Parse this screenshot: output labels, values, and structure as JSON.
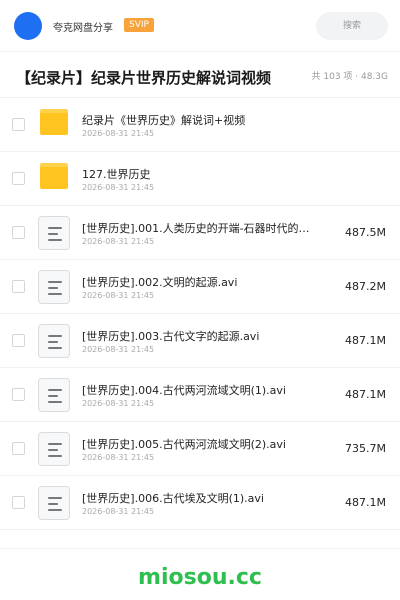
{
  "header": {
    "brand": "夸克网盘分享",
    "badge": "SVIP",
    "search_placeholder": "搜索"
  },
  "folder_title": "【纪录片】纪录片世界历史解说词视频",
  "summary": "共 103 项 · 48.3G",
  "items": [
    {
      "type": "folder",
      "name": "纪录片《世界历史》解说词+视频",
      "date": "2026-08-31 21:45",
      "size": ""
    },
    {
      "type": "folder",
      "name": "127.世界历史",
      "date": "2026-08-31 21:45",
      "size": ""
    },
    {
      "type": "file",
      "name": "[世界历史].001.人类历史的开端-石器时代的人…",
      "date": "2026-08-31 21:45",
      "size": "487.5M"
    },
    {
      "type": "file",
      "name": "[世界历史].002.文明的起源.avi",
      "date": "2026-08-31 21:45",
      "size": "487.2M"
    },
    {
      "type": "file",
      "name": "[世界历史].003.古代文字的起源.avi",
      "date": "2026-08-31 21:45",
      "size": "487.1M"
    },
    {
      "type": "file",
      "name": "[世界历史].004.古代两河流域文明(1).avi",
      "date": "2026-08-31 21:45",
      "size": "487.1M"
    },
    {
      "type": "file",
      "name": "[世界历史].005.古代两河流域文明(2).avi",
      "date": "2026-08-31 21:45",
      "size": "735.7M"
    },
    {
      "type": "file",
      "name": "[世界历史].006.古代埃及文明(1).avi",
      "date": "2026-08-31 21:45",
      "size": "487.1M"
    }
  ],
  "watermark": "miosou.cc"
}
